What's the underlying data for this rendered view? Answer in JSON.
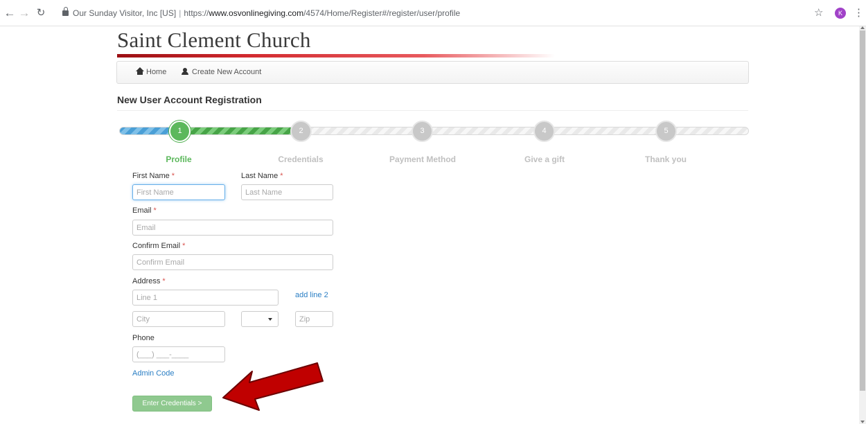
{
  "browser": {
    "origin_label": "Our Sunday Visitor, Inc [US]",
    "url_scheme": "https://",
    "url_host": "www.osvonlinegiving.com",
    "url_path": "/4574/Home/Register#/register/user/profile",
    "profile_initial": "K",
    "icons": [
      "back-arrow-icon",
      "forward-arrow-icon",
      "reload-icon",
      "lock-icon",
      "star-icon",
      "menu-kebab-icon"
    ]
  },
  "header": {
    "church_name": "Saint Clement Church",
    "rule_color": "#c8181e"
  },
  "breadcrumb": {
    "home": "Home",
    "create": "Create New Account"
  },
  "page": {
    "heading": "New User Account Registration"
  },
  "wizard": {
    "current_step": 1,
    "steps": [
      {
        "number": "1",
        "label": "Profile"
      },
      {
        "number": "2",
        "label": "Credentials"
      },
      {
        "number": "3",
        "label": "Payment Method"
      },
      {
        "number": "4",
        "label": "Give a gift"
      },
      {
        "number": "5",
        "label": "Thank you"
      }
    ],
    "active_color": "#5cb85c"
  },
  "form": {
    "required_mark": "*",
    "first_name": {
      "label": "First Name",
      "placeholder": "First Name",
      "value": ""
    },
    "last_name": {
      "label": "Last Name",
      "placeholder": "Last Name",
      "value": ""
    },
    "email": {
      "label": "Email",
      "placeholder": "Email",
      "value": ""
    },
    "confirm_email": {
      "label": "Confirm Email",
      "placeholder": "Confirm Email",
      "value": ""
    },
    "address": {
      "label": "Address",
      "line1_placeholder": "Line 1",
      "add_line2": "add line 2",
      "city_placeholder": "City",
      "state_value": "",
      "zip_placeholder": "Zip"
    },
    "phone": {
      "label": "Phone",
      "placeholder": "(___) ___-____",
      "value": ""
    },
    "admin_code_link": "Admin Code",
    "submit_label": "Enter Credentials >"
  },
  "annotation": {
    "arrow_color": "#c00000"
  }
}
